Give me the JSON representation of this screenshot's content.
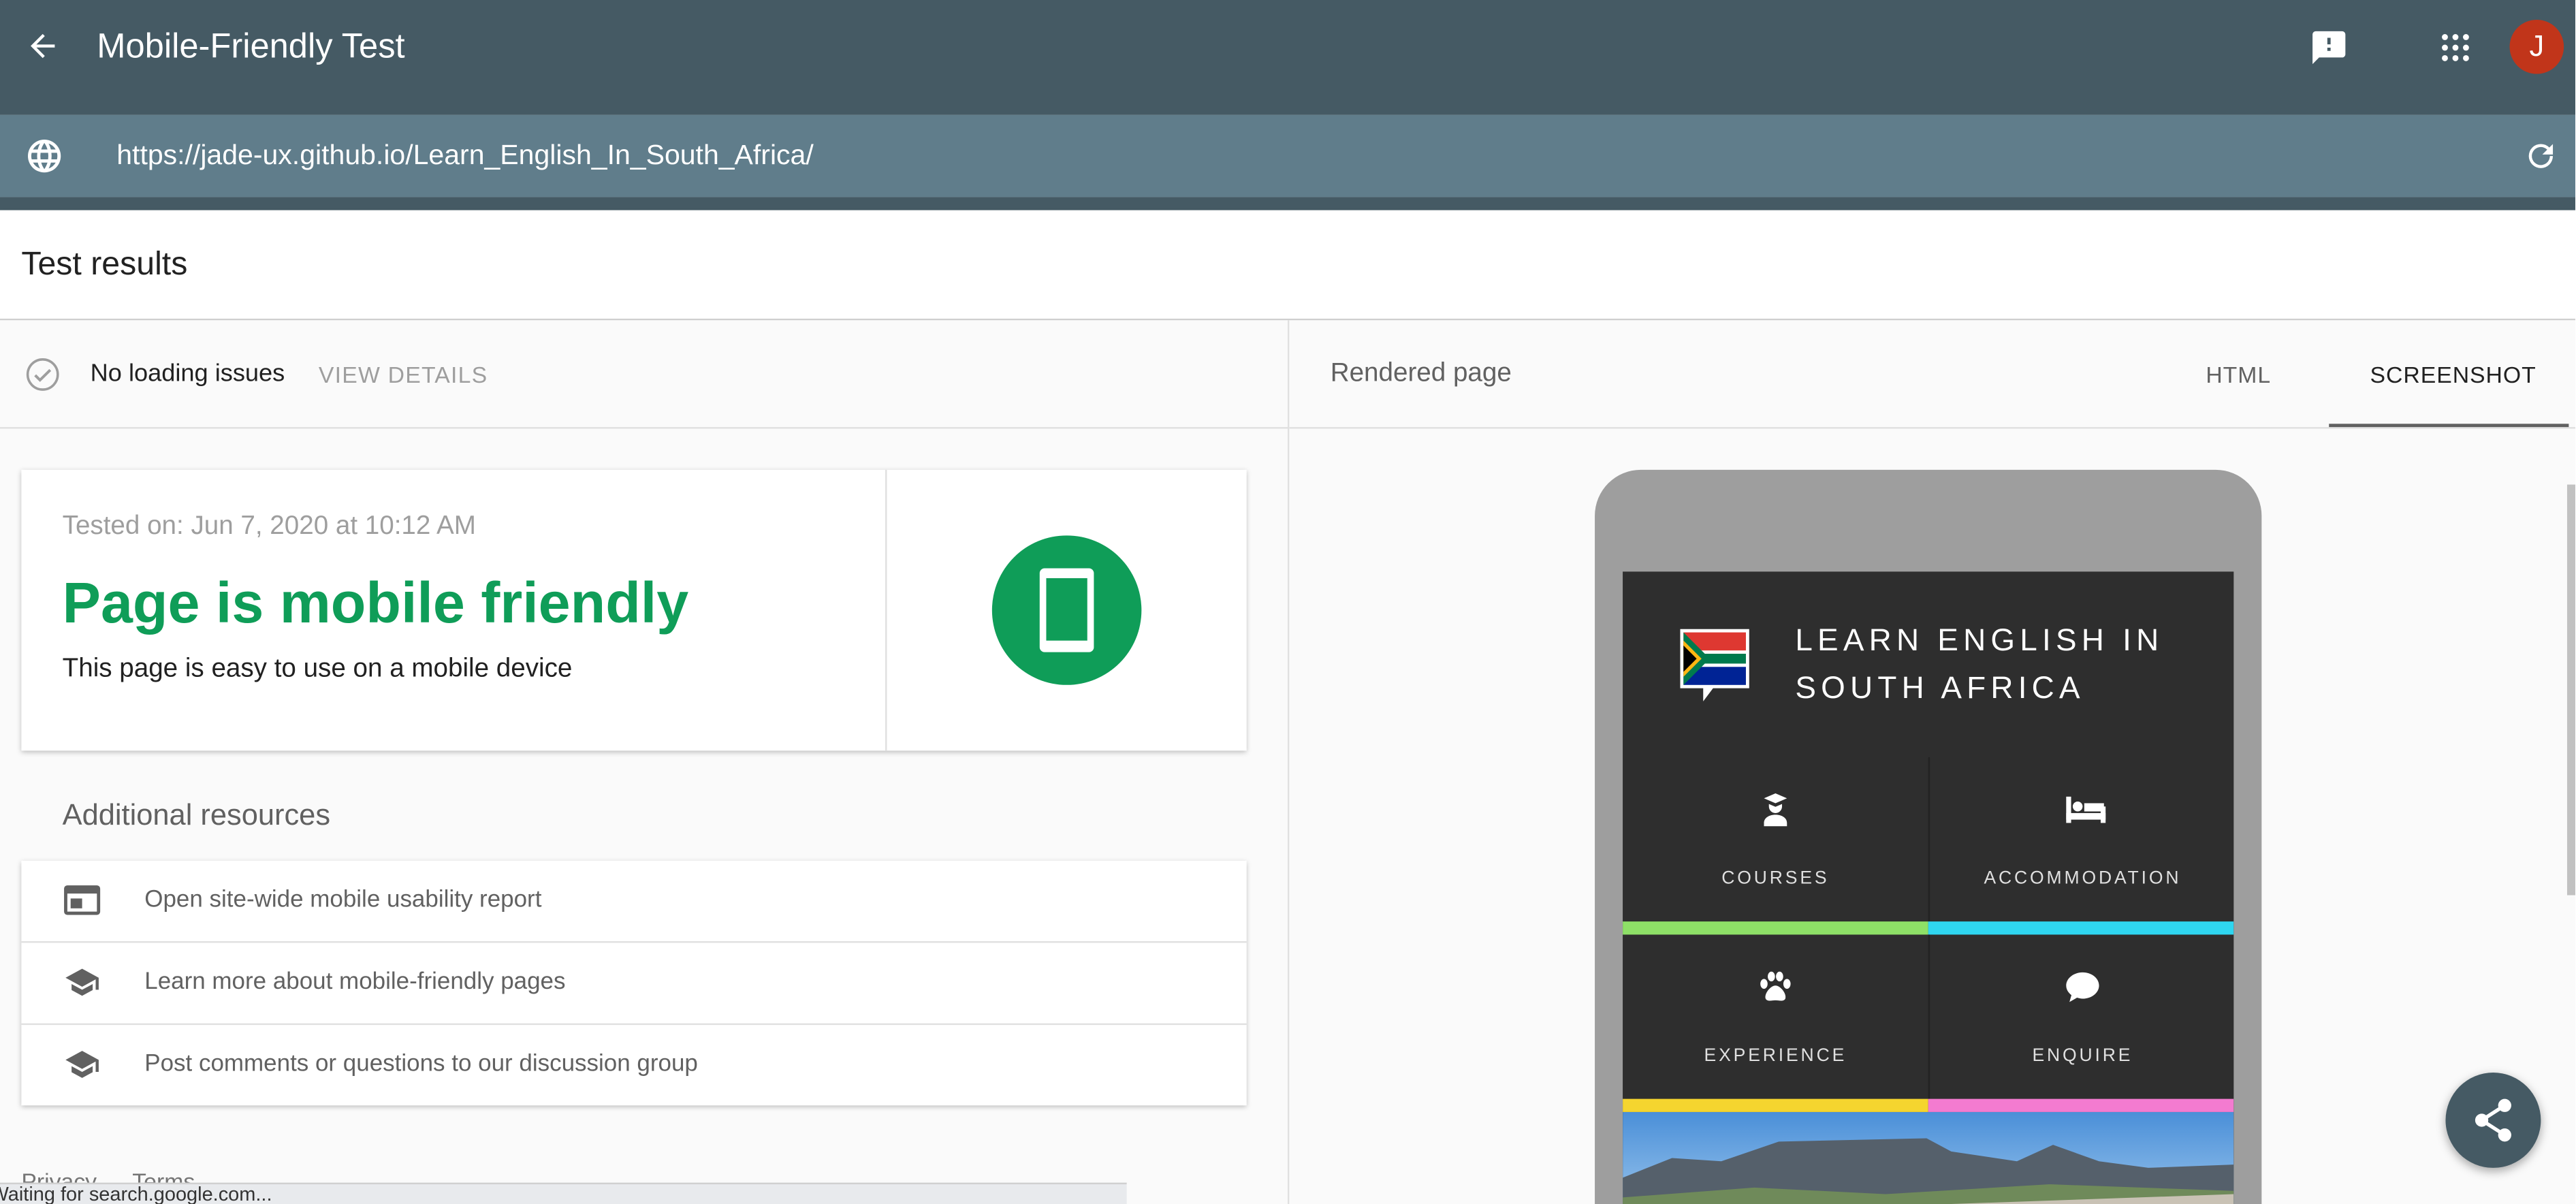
{
  "app": {
    "title": "Mobile-Friendly Test",
    "avatar_initial": "J",
    "avatar_color": "#c1351a"
  },
  "url": {
    "value": "https://jade-ux.github.io/Learn_English_In_South_Africa/"
  },
  "results": {
    "heading": "Test results"
  },
  "status": {
    "text": "No loading issues",
    "link": "VIEW DETAILS"
  },
  "verdict": {
    "tested_on": "Tested on: Jun 7, 2020 at 10:12 AM",
    "title": "Page is mobile friendly",
    "subtitle": "This page is easy to use on a mobile device",
    "color": "#0f9d58"
  },
  "resources": {
    "heading": "Additional resources",
    "items": [
      {
        "label": "Open site-wide mobile usability report",
        "icon": "web-report-icon"
      },
      {
        "label": "Learn more about mobile-friendly pages",
        "icon": "school-icon"
      },
      {
        "label": "Post comments or questions to our discussion group",
        "icon": "school-icon"
      }
    ]
  },
  "footer": {
    "privacy": "Privacy",
    "terms": "Terms"
  },
  "loading": {
    "text": "Waiting for search.google.com..."
  },
  "rendered": {
    "label": "Rendered page",
    "tabs": [
      {
        "label": "HTML"
      },
      {
        "label": "SCREENSHOT"
      }
    ],
    "active_tab": "SCREENSHOT"
  },
  "site": {
    "title_line1": "LEARN ENGLISH IN",
    "title_line2": "SOUTH AFRICA",
    "tiles": [
      {
        "label": "COURSES",
        "stripe": "#8ee067"
      },
      {
        "label": "ACCOMMODATION",
        "stripe": "#2fd6f0"
      },
      {
        "label": "EXPERIENCE",
        "stripe": "#f5d52f"
      },
      {
        "label": "ENQUIRE",
        "stripe": "#f37bd0"
      }
    ]
  }
}
